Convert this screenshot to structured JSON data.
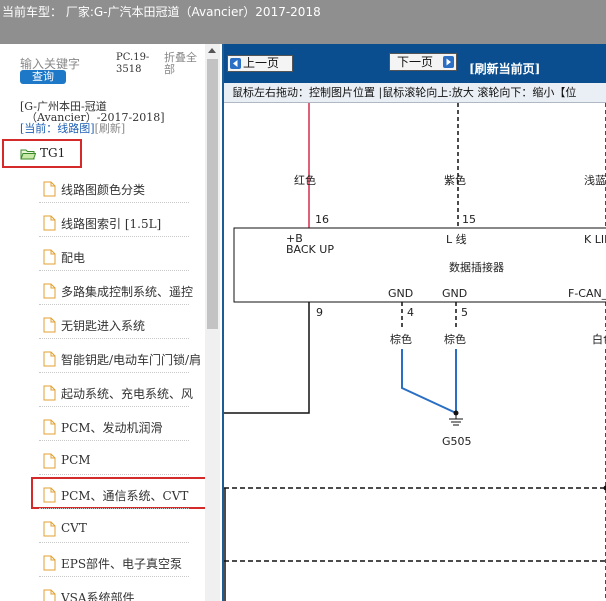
{
  "title_bar": {
    "text": "当前车型：  厂家:G-广汽本田冠道（Avancier）2017-2018"
  },
  "sidebar": {
    "search_placeholder": "输入关键字",
    "query_label": "查询",
    "pc_code": "PC.19-3518",
    "collapse_label": "折叠全部",
    "vehicle_line1": "[G-广州本田-冠道",
    "vehicle_line2": "（Avancier）-2017-2018]",
    "current_label": "[当前：线路图]",
    "refresh_label": "[刷新]",
    "root_label": "TG1",
    "items": [
      "线路图颜色分类",
      "线路图索引 [1.5L]",
      "配电",
      "多路集成控制系统、遥控",
      "无钥匙进入系统",
      "智能钥匙/电动车门门锁/肩",
      "起动系统、充电系统、风",
      "PCM、发动机润滑",
      "PCM",
      "PCM、通信系统、CVT",
      "CVT",
      "EPS部件、电子真空泵",
      "VSA系统部件"
    ]
  },
  "viewer": {
    "prev_label": "上一页",
    "next_label": "下一页",
    "refresh_label": "[刷新当前页]",
    "hint": "鼠标左右拖动：控制图片位置 |鼠标滚轮向上:放大  滚轮向下：缩小【位"
  },
  "diagram": {
    "wire_red": "红色",
    "wire_purple": "紫色",
    "wire_blue": "浅蓝",
    "pin_16": "16",
    "pin_15": "15",
    "label_b": "+B",
    "label_backup": "BACK UP",
    "label_lline": "L 线",
    "label_kline": "K LIN",
    "connector": "数据插接器",
    "gnd1": "GND",
    "gnd2": "GND",
    "fcan": "F-CAN_",
    "pin_9": "9",
    "pin_4": "4",
    "pin_5": "5",
    "brown1": "棕色",
    "brown2": "棕色",
    "white": "白色",
    "ground": "G505",
    "colors": {
      "red_wire": "#d42a4a",
      "blue_wire": "#2a6fc4",
      "toolbar": "#0a4e8f"
    }
  }
}
